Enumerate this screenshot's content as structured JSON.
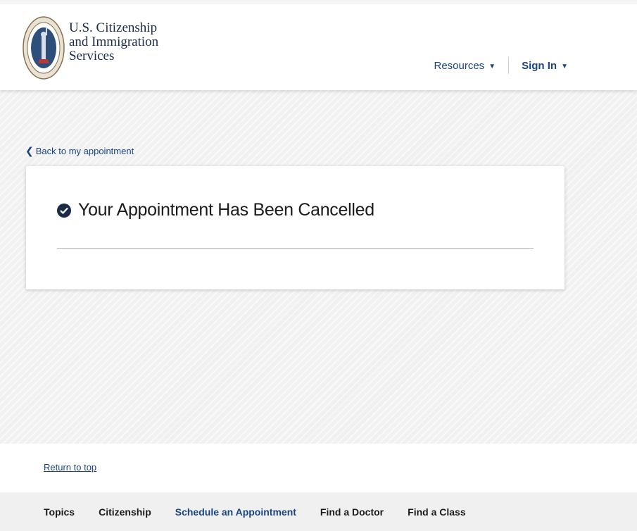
{
  "header": {
    "logo_lines": [
      "U.S. Citizenship",
      "and Immigration",
      "Services"
    ],
    "resources_label": "Resources",
    "signin_label": "Sign In",
    "caret_icon": "caret-down-icon"
  },
  "main": {
    "back_label": "Back to my appointment",
    "card_title": "Your Appointment Has Been Cancelled"
  },
  "footer": {
    "return_to_top": "Return to top",
    "nav_items": [
      "Topics",
      "Citizenship",
      "Schedule an Appointment",
      "Find a Doctor",
      "Find a Class"
    ]
  },
  "colors": {
    "brand_navy": "#1a2b48",
    "link_blue": "#1a4480"
  }
}
